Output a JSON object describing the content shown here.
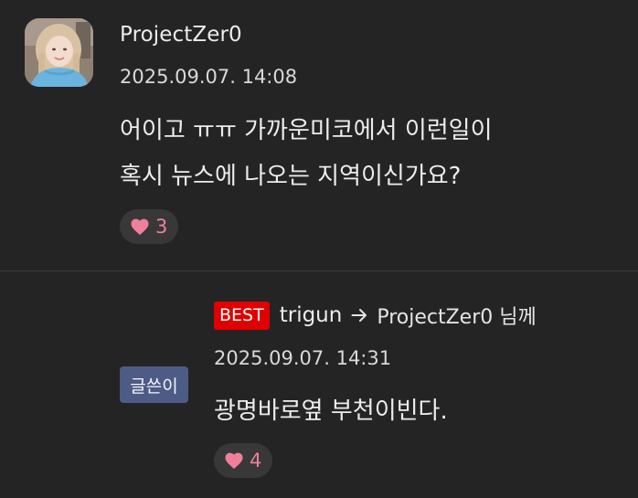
{
  "comment": {
    "author": "ProjectZer0",
    "timestamp": "2025.09.07. 14:08",
    "body_lines": [
      "어이고 ㅠㅠ 가까운미코에서 이런일이",
      "혹시 뉴스에 나오는 지역이신가요?"
    ],
    "likes": "3"
  },
  "reply": {
    "writer_badge": "글쓴이",
    "best_badge": "BEST",
    "author": "trigun",
    "target": "ProjectZer0 님께",
    "timestamp": "2025.09.07. 14:31",
    "body": "광명바로옆 부천이빈다.",
    "likes": "4"
  },
  "colors": {
    "background": "#242424",
    "like_pill": "#383838",
    "heart": "#f07f9a",
    "best_badge": "#e00000",
    "writer_badge": "#4e5b86",
    "divider": "#3c3c3c"
  },
  "icons": {
    "like": "heart-icon",
    "reply_direction": "arrow-right-icon"
  }
}
